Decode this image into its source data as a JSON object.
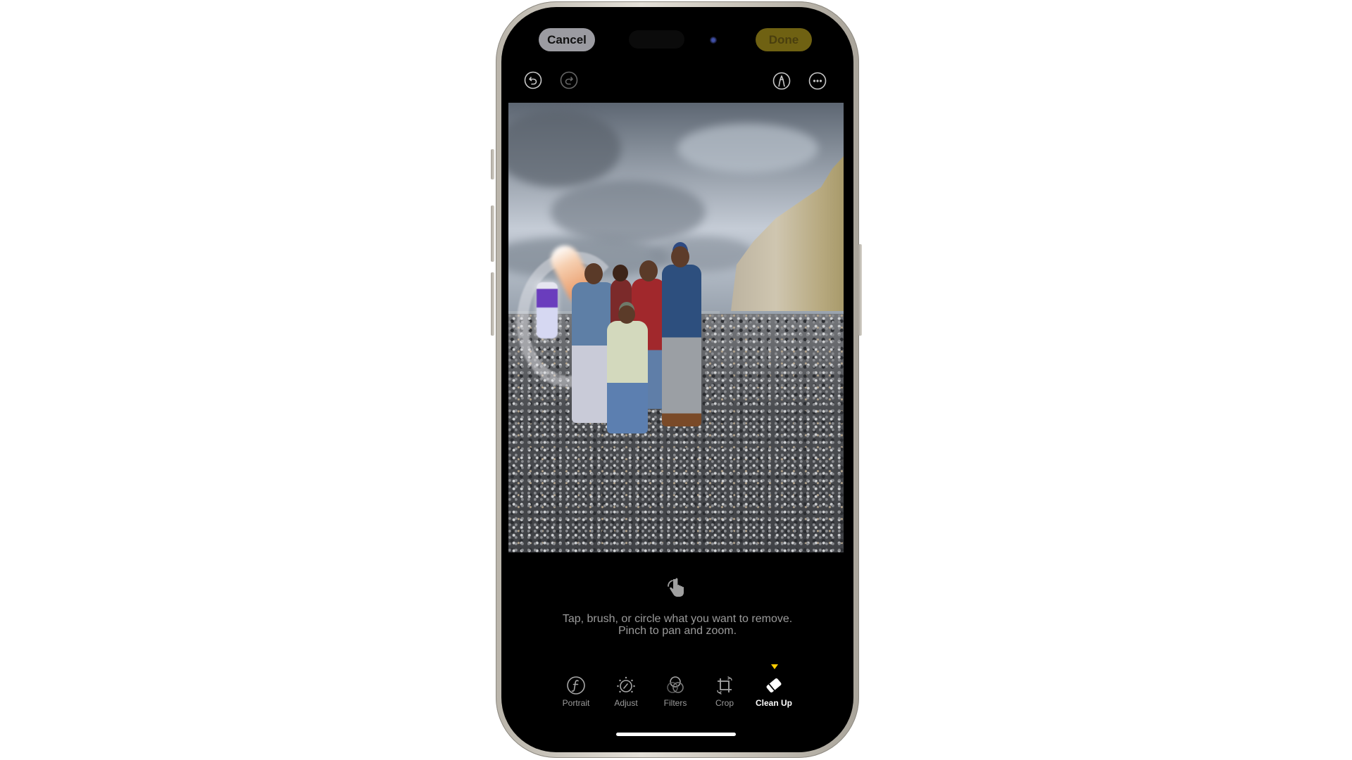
{
  "app": "Photos",
  "mode": "Clean Up",
  "top_bar": {
    "cancel_label": "Cancel",
    "done_label": "Done",
    "done_enabled": false,
    "accent_color": "#ffcc00"
  },
  "secondary_bar": {
    "undo_icon": "undo-icon",
    "redo_icon": "redo-icon",
    "markup_icon": "markup-pen-icon",
    "more_icon": "more-ellipsis-icon"
  },
  "photo": {
    "description": "Family of five on a pebble beach beside white chalk cliffs under a cloudy sky; a background person with a selfie stick is circled for removal"
  },
  "hint": {
    "icon": "hand-tap-gesture-icon",
    "line1": "Tap, brush, or circle what you want to remove.",
    "line2": "Pinch to pan and zoom."
  },
  "tools": [
    {
      "label": "Portrait",
      "icon": "portrait-f-icon",
      "active": false
    },
    {
      "label": "Adjust",
      "icon": "adjust-dial-icon",
      "active": false
    },
    {
      "label": "Filters",
      "icon": "filters-circles-icon",
      "active": false
    },
    {
      "label": "Crop",
      "icon": "crop-rotate-icon",
      "active": false
    },
    {
      "label": "Clean Up",
      "icon": "eraser-icon",
      "active": true
    }
  ]
}
